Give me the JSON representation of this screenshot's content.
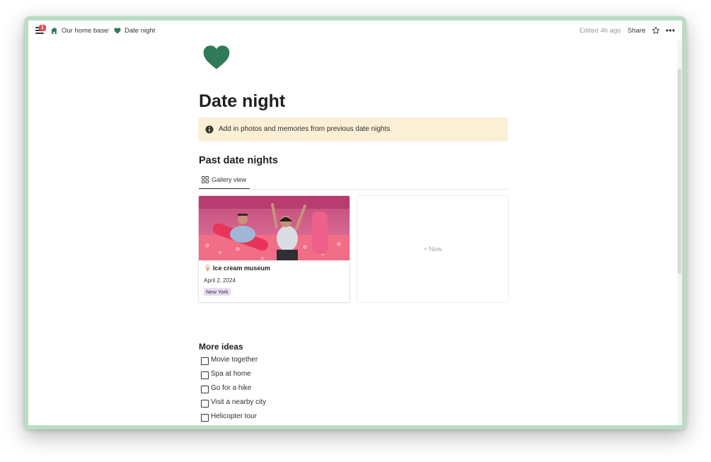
{
  "header": {
    "notification_count": "1",
    "breadcrumb": [
      {
        "label": "Our home base",
        "icon": "house-icon"
      },
      {
        "label": "Date night",
        "icon": "heart-icon"
      }
    ],
    "separator": "/",
    "edited": "Edited 4h ago",
    "share_label": "Share"
  },
  "page": {
    "icon": "heart-icon",
    "icon_color": "#2f7b57",
    "title": "Date night",
    "callout": {
      "icon": "info-icon",
      "text": "Add in photos and memories from previous date nights",
      "bg": "#fbefd6"
    }
  },
  "database": {
    "title": "Past date nights",
    "view": {
      "label": "Gallery view",
      "icon": "gallery-icon"
    },
    "cards": [
      {
        "emoji": "ice-cream-icon",
        "title": "Ice cream museum",
        "date": "April 2, 2024",
        "tag": "New York"
      }
    ],
    "new_label": "+ New"
  },
  "ideas": {
    "title": "More ideas",
    "items": [
      {
        "label": "Movie together",
        "checked": false
      },
      {
        "label": "Spa at home",
        "checked": false
      },
      {
        "label": "Go for a hike",
        "checked": false
      },
      {
        "label": "Visit a nearby city",
        "checked": false
      },
      {
        "label": "Helicopter tour",
        "checked": false
      }
    ]
  },
  "colors": {
    "frame": "#b9dcc5",
    "accent_green": "#2f7b57",
    "tag_bg": "#e8deee",
    "badge": "#e5484d"
  }
}
